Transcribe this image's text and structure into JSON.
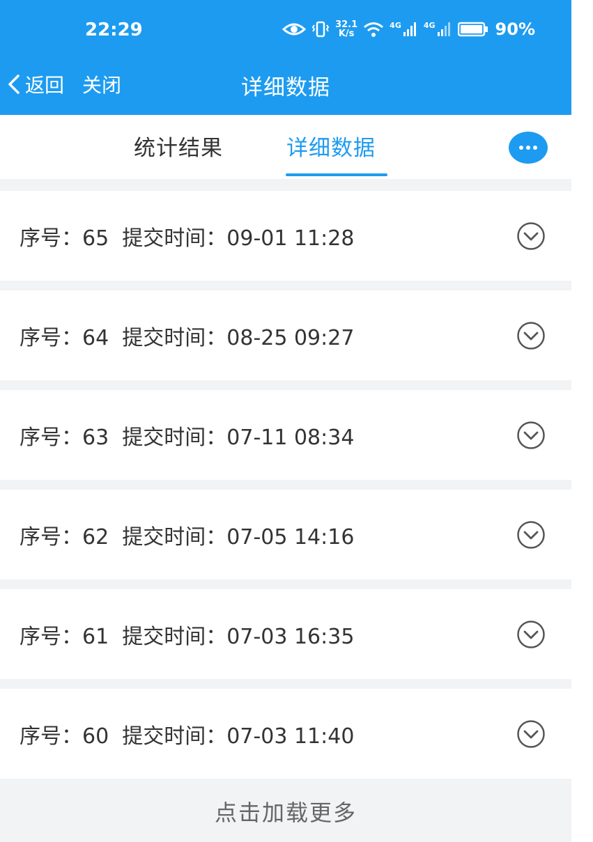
{
  "status_bar": {
    "time": "22:29",
    "net_speed_value": "32.1",
    "net_speed_unit": "K/s",
    "network_label_1": "4G",
    "network_label_2": "4G",
    "battery": "90%",
    "icons": [
      "eye-icon",
      "vibrate-icon",
      "wifi-icon",
      "signal-icon",
      "signal-icon",
      "battery-icon"
    ]
  },
  "nav": {
    "back_label": "返回",
    "close_label": "关闭",
    "title": "详细数据"
  },
  "tabs": {
    "stats_label": "统计结果",
    "detail_label": "详细数据",
    "active": "详细数据"
  },
  "records": [
    {
      "seq_label": "序号",
      "seq": "65",
      "time_label": "提交时间",
      "time": "09-01 11:28"
    },
    {
      "seq_label": "序号",
      "seq": "64",
      "time_label": "提交时间",
      "time": "08-25 09:27"
    },
    {
      "seq_label": "序号",
      "seq": "63",
      "time_label": "提交时间",
      "time": "07-11 08:34"
    },
    {
      "seq_label": "序号",
      "seq": "62",
      "time_label": "提交时间",
      "time": "07-05 14:16"
    },
    {
      "seq_label": "序号",
      "seq": "61",
      "time_label": "提交时间",
      "time": "07-03 16:35"
    },
    {
      "seq_label": "序号",
      "seq": "60",
      "time_label": "提交时间",
      "time": "07-03 11:40"
    }
  ],
  "load_more_label": "点击加载更多",
  "colors": {
    "accent": "#1d9bf0",
    "background": "#f2f3f5",
    "text": "#333333"
  }
}
